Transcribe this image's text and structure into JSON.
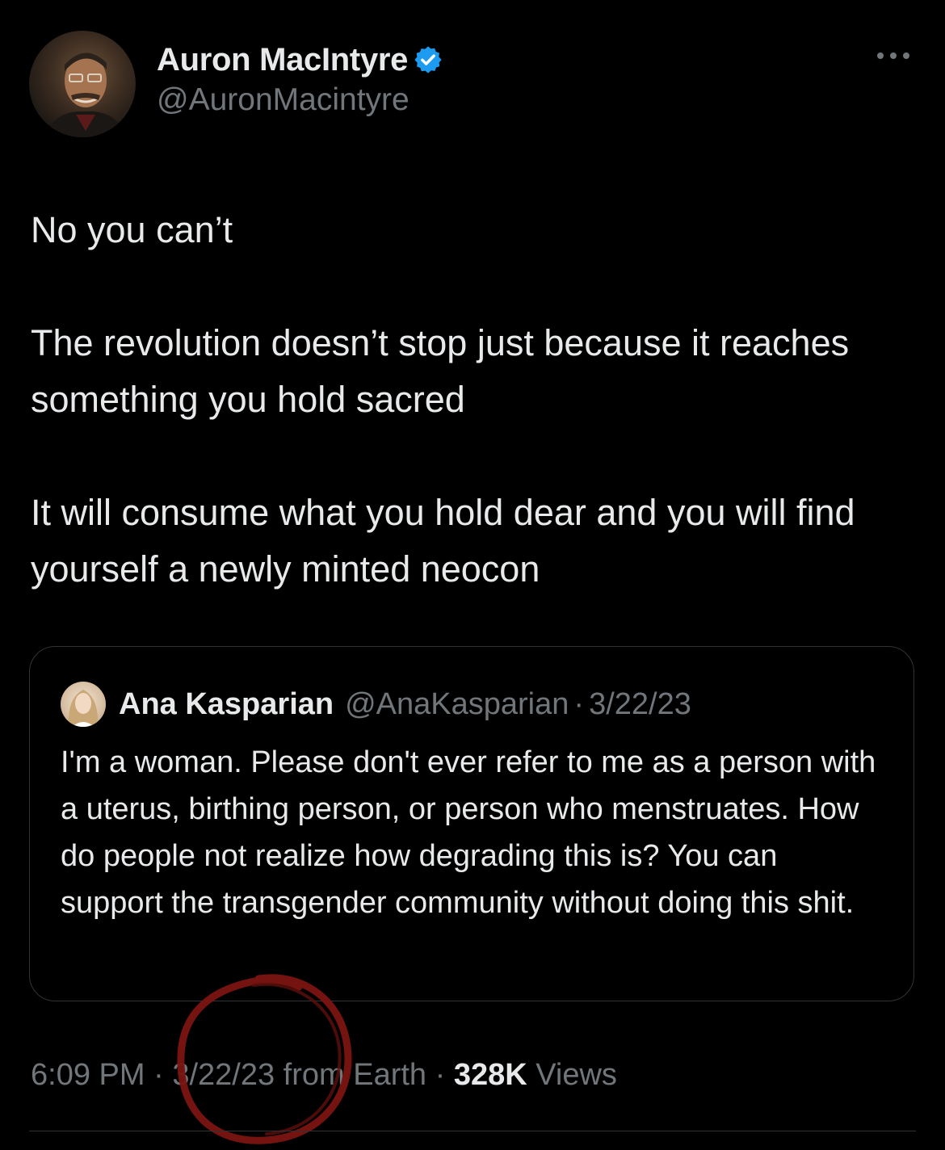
{
  "tweet": {
    "author": {
      "display_name": "Auron MacIntyre",
      "handle": "@AuronMacintyre",
      "verified_icon": "verified-badge-icon",
      "badge_color": "#1d9bf0"
    },
    "more_icon": "more-horizontal-icon",
    "body": [
      "No you can’t",
      "The revolution doesn’t stop just because it reaches something you hold sacred",
      "It will consume what you hold dear and you will find yourself a newly minted neocon"
    ],
    "quote": {
      "display_name": "Ana Kasparian",
      "handle": "@AnaKasparian",
      "separator": "·",
      "date": "3/22/23",
      "text": "I'm a woman. Please don't ever refer to me as a person with a uterus, birthing person, or person who menstruates. How do people not realize how degrading this is? You can support the transgender community without doing this shit."
    },
    "meta": {
      "time": "6:09 PM",
      "separator": "·",
      "date": "3/22/23",
      "source": "from Earth",
      "views_count": "328K",
      "views_label": "Views"
    },
    "colors": {
      "background": "#000000",
      "text": "#e7e9ea",
      "muted": "#71767b",
      "border": "#2f3336",
      "annotation": "#7a1410"
    }
  }
}
